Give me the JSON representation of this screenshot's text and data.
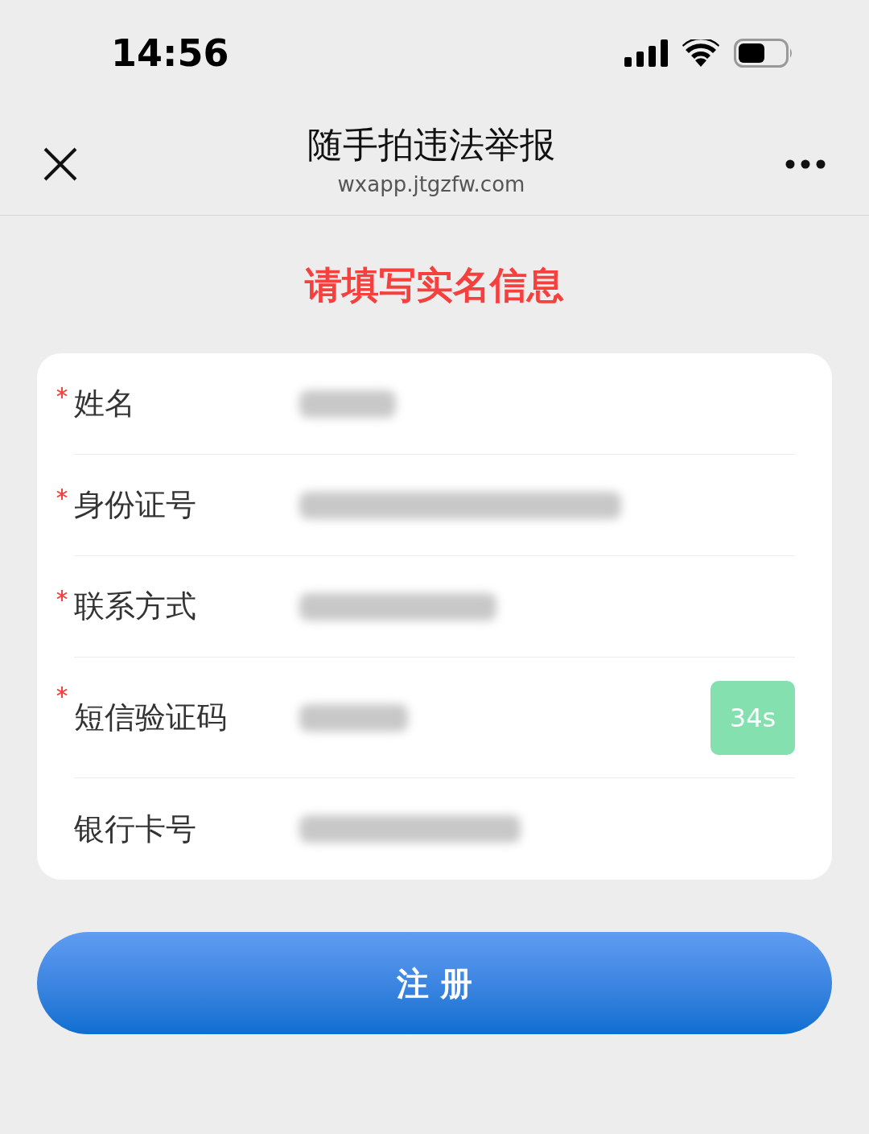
{
  "status_bar": {
    "time": "14:56"
  },
  "nav": {
    "title": "随手拍违法举报",
    "subtitle": "wxapp.jtgzfw.com"
  },
  "heading": "请填写实名信息",
  "fields": [
    {
      "label": "姓名",
      "required": true,
      "value_hidden": true,
      "kind": "text"
    },
    {
      "label": "身份证号",
      "required": true,
      "value_hidden": true,
      "kind": "text"
    },
    {
      "label": "联系方式",
      "required": true,
      "value_hidden": true,
      "kind": "text"
    },
    {
      "label": "短信验证码",
      "required": true,
      "value_hidden": true,
      "kind": "code",
      "countdown": "34s"
    },
    {
      "label": "银行卡号",
      "required": false,
      "value_hidden": true,
      "kind": "text"
    }
  ],
  "submit": "注 册"
}
